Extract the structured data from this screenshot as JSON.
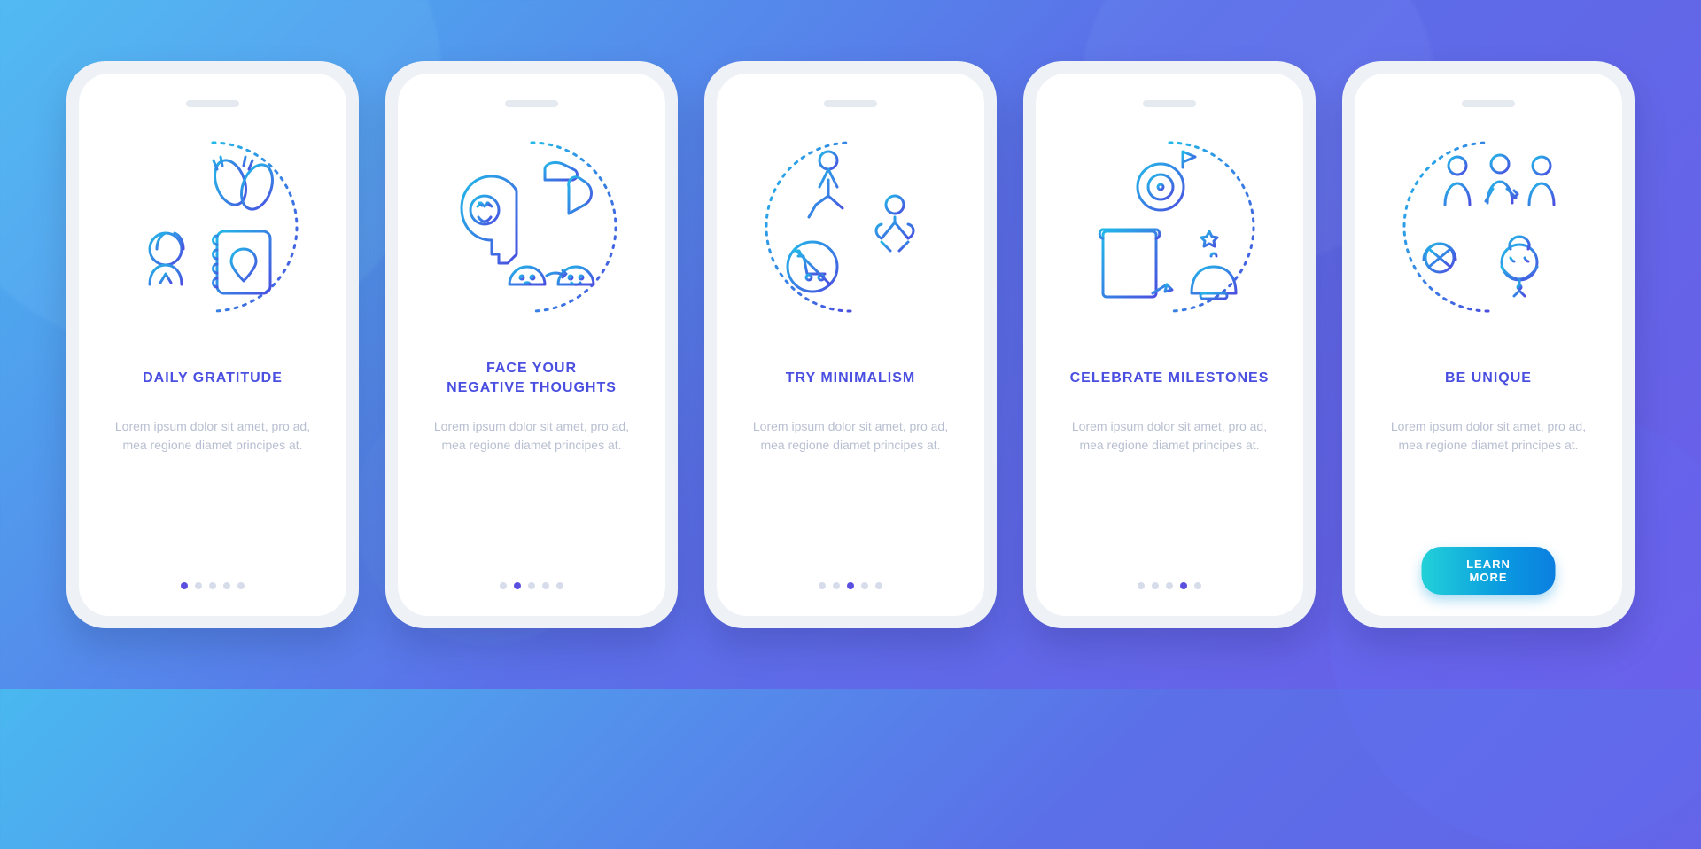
{
  "screens": [
    {
      "title": "DAILY GRATITUDE",
      "body": "Lorem ipsum dolor sit amet, pro ad, mea regione diamet principes at.",
      "icon": "gratitude-icon",
      "activeIndex": 0
    },
    {
      "title": "FACE YOUR\nNEGATIVE THOUGHTS",
      "body": "Lorem ipsum dolor sit amet, pro ad, mea regione diamet principes at.",
      "icon": "negative-thoughts-icon",
      "activeIndex": 1
    },
    {
      "title": "TRY MINIMALISM",
      "body": "Lorem ipsum dolor sit amet, pro ad, mea regione diamet principes at.",
      "icon": "minimalism-icon",
      "activeIndex": 2
    },
    {
      "title": "CELEBRATE MILESTONES",
      "body": "Lorem ipsum dolor sit amet, pro ad, mea regione diamet principes at.",
      "icon": "milestones-icon",
      "activeIndex": 3
    },
    {
      "title": "BE UNIQUE",
      "body": "Lorem ipsum dolor sit amet, pro ad, mea regione diamet principes at.",
      "icon": "unique-icon",
      "activeIndex": 4
    }
  ],
  "cta_label": "LEARN MORE",
  "total_dots": 5
}
